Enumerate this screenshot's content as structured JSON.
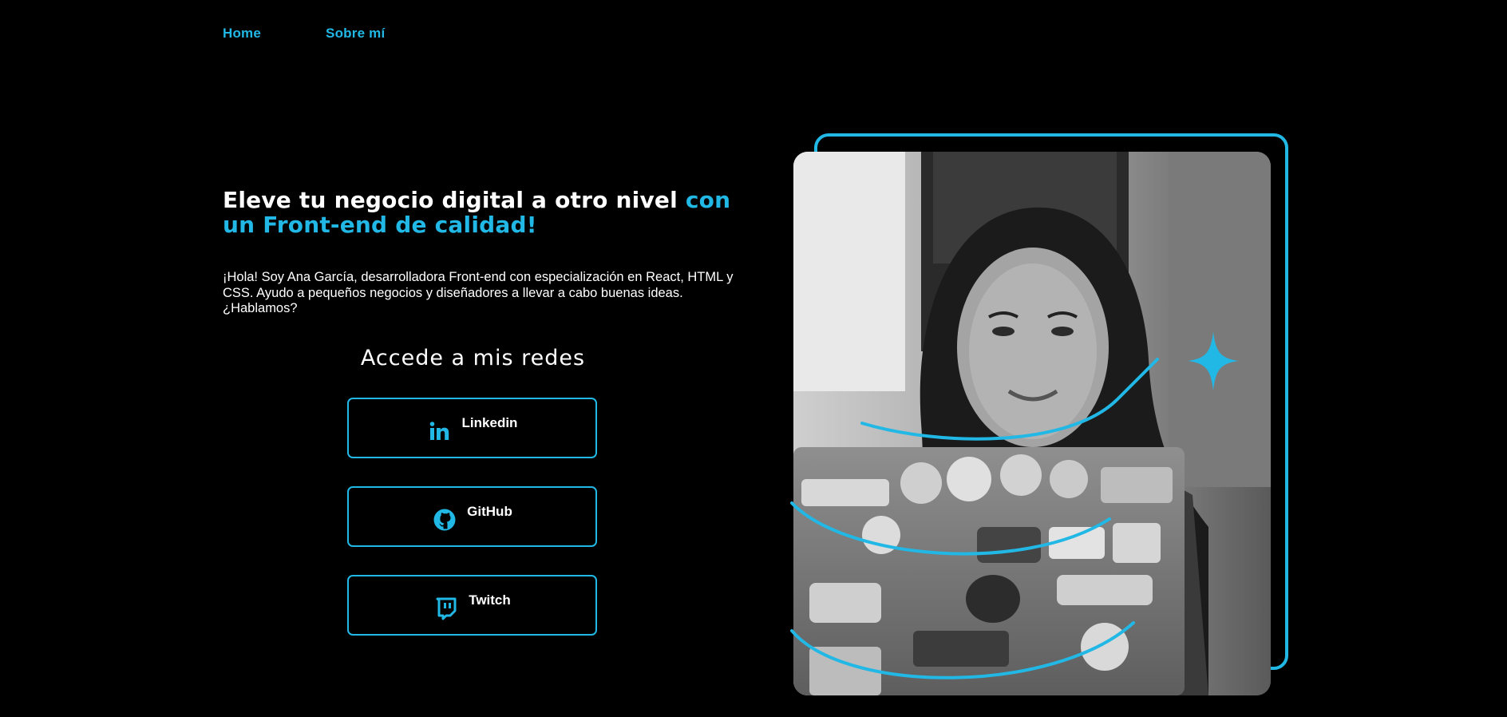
{
  "nav": {
    "home_label": "Home",
    "about_label": "Sobre mí"
  },
  "hero": {
    "title_main": "Eleve tu negocio digital a otro nivel ",
    "title_accent": "con un Front-end de calidad!",
    "description": "¡Hola! Soy Ana García, desarrolladora Front-end con especialización en React, HTML y CSS. Ayudo a pequeños negocios y diseñadores a llevar a cabo buenas ideas. ¿Hablamos?"
  },
  "social": {
    "heading": "Accede a mis redes",
    "buttons": [
      {
        "label": "Linkedin",
        "icon": "linkedin-icon"
      },
      {
        "label": "GitHub",
        "icon": "github-icon"
      },
      {
        "label": "Twitch",
        "icon": "twitch-icon"
      }
    ]
  },
  "image": {
    "subject": "profile-photo",
    "decoration": "sparkle-star-icon"
  },
  "colors": {
    "background": "#000000",
    "accent": "#22b8e6",
    "text": "#ffffff"
  }
}
